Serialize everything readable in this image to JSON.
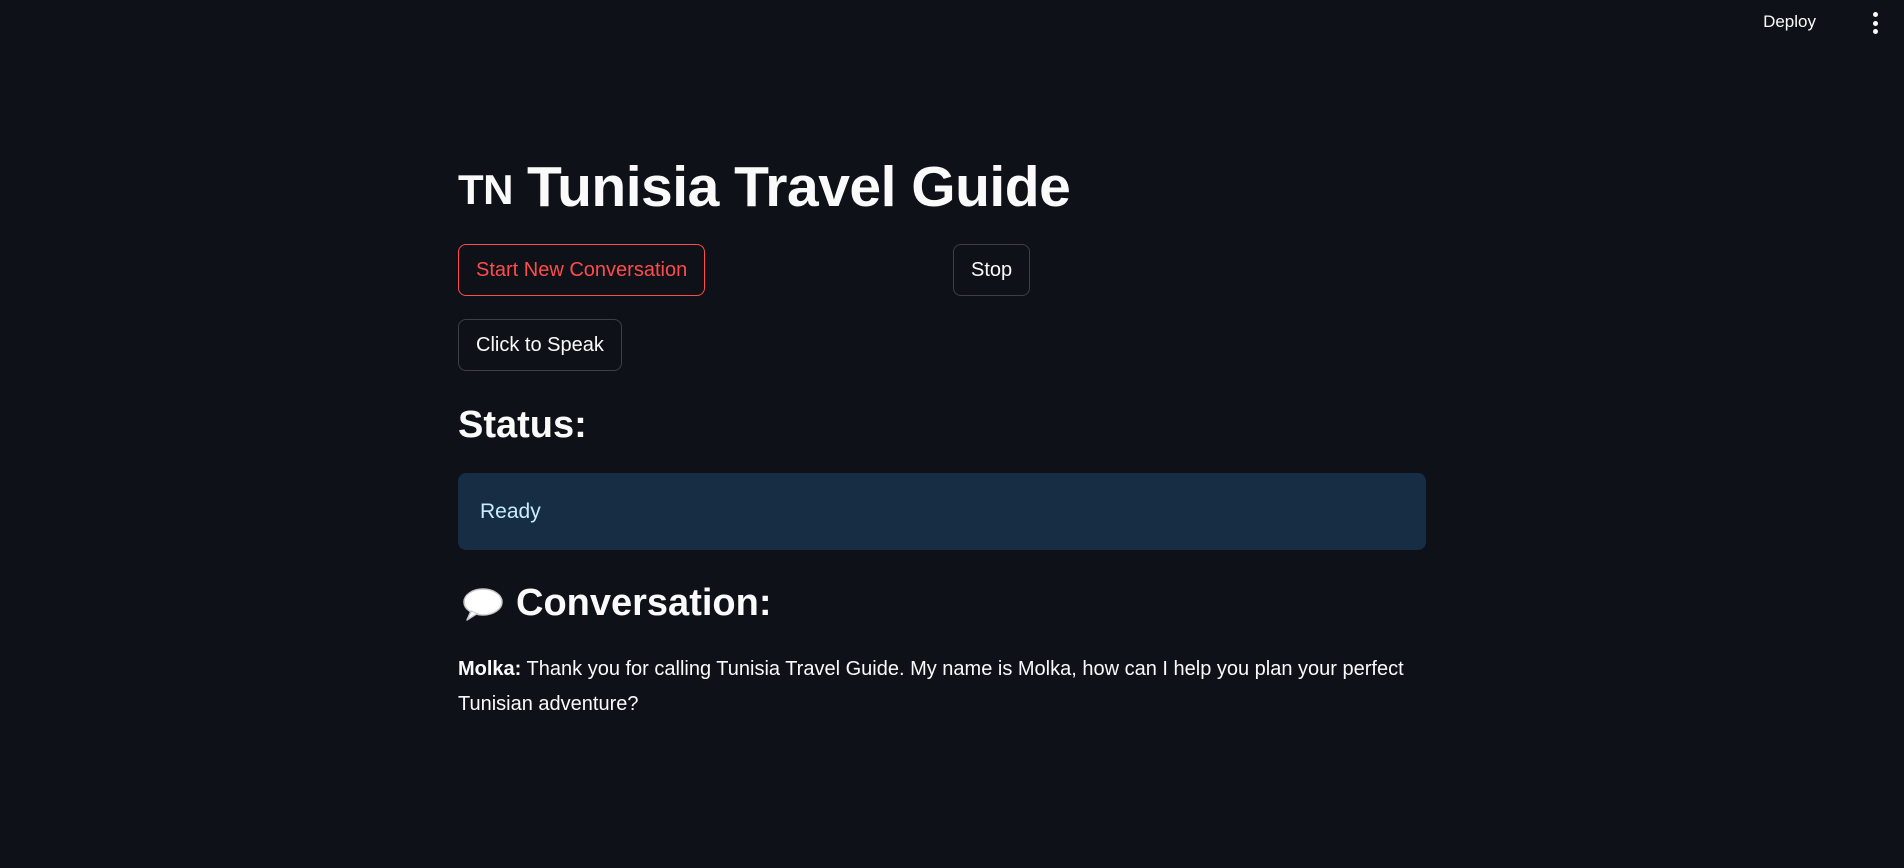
{
  "header": {
    "deploy_label": "Deploy",
    "menu_icon": "kebab-menu-icon"
  },
  "main": {
    "title_flag": "TN",
    "title": "Tunisia Travel Guide",
    "buttons": {
      "start_label": "Start New Conversation",
      "stop_label": "Stop",
      "speak_label": "Click to Speak"
    },
    "status": {
      "heading": "Status:",
      "value": "Ready"
    },
    "conversation": {
      "icon": "speech-balloon-icon",
      "heading": "Conversation:",
      "messages": [
        {
          "speaker": "Molka:",
          "text": "Thank you for calling Tunisia Travel Guide. My name is Molka, how can I help you plan your perfect Tunisian adventure?"
        }
      ]
    }
  },
  "colors": {
    "background": "#0e1117",
    "accent": "#ff4b4b",
    "status_bg": "#172d43",
    "status_text": "#c7ebff"
  }
}
